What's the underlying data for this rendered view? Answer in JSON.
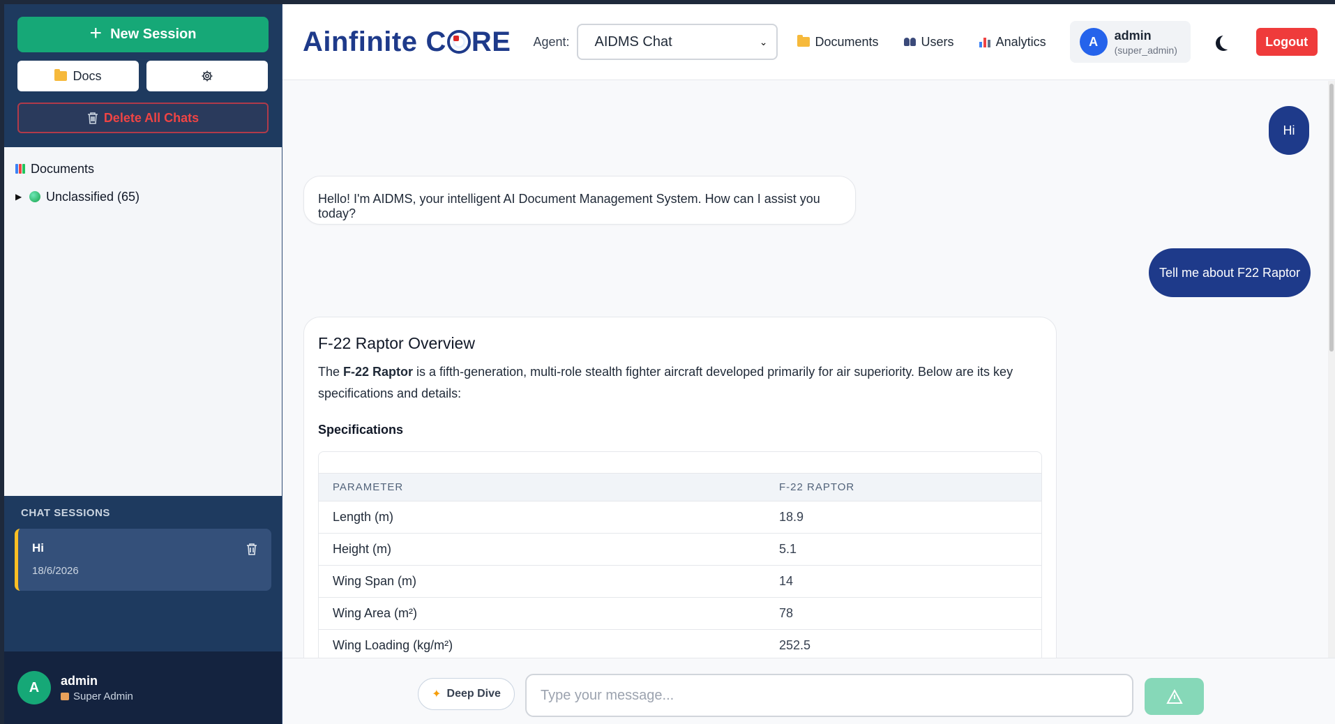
{
  "sidebar": {
    "new_session_label": "New Session",
    "docs_label": "Docs",
    "delete_all_label": "Delete All Chats",
    "tree": {
      "documents_label": "Documents",
      "unclassified_label": "Unclassified (65)"
    },
    "sessions_title": "CHAT SESSIONS",
    "sessions": [
      {
        "name": "Hi",
        "date": "18/6/2026"
      }
    ],
    "user": {
      "initial": "A",
      "name": "admin",
      "role": "Super Admin"
    }
  },
  "header": {
    "logo_part1": "Ainfinite",
    "logo_core_c": "C",
    "logo_core_rest": "RE",
    "agent_label": "Agent:",
    "agent_value": "AIDMS Chat",
    "nav": {
      "documents": "Documents",
      "users": "Users",
      "analytics": "Analytics"
    },
    "user": {
      "initial": "A",
      "name": "admin",
      "role": "(super_admin)"
    },
    "logout_label": "Logout"
  },
  "chat": {
    "messages": [
      {
        "role": "user",
        "text": "Hi"
      },
      {
        "role": "assistant",
        "text": "Hello! I'm AIDMS, your intelligent AI Document Management System. How can I assist you today?"
      },
      {
        "role": "user",
        "text": "Tell me about F22 Raptor"
      }
    ],
    "card": {
      "title": "F-22 Raptor Overview",
      "intro_pre": "The ",
      "intro_bold": "F-22 Raptor",
      "intro_post": " is a fifth-generation, multi-role stealth fighter aircraft developed primarily for air superiority. Below are its key specifications and details:",
      "subtitle": "Specifications",
      "table": {
        "headers": [
          "PARAMETER",
          "F-22 RAPTOR"
        ],
        "rows": [
          [
            "Length (m)",
            "18.9"
          ],
          [
            "Height (m)",
            "5.1"
          ],
          [
            "Wing Span (m)",
            "14"
          ],
          [
            "Wing Area (m²)",
            "78"
          ],
          [
            "Wing Loading (kg/m²)",
            "252.5"
          ]
        ]
      }
    }
  },
  "composer": {
    "deep_dive_label": "Deep Dive",
    "placeholder": "Type your message..."
  },
  "colors": {
    "primary_green": "#16a877",
    "navy": "#1e3a8a",
    "sidebar_bg": "#1e3a5f",
    "logout_red": "#ef3b3b",
    "accent_yellow": "#fbbf24"
  },
  "icons": {
    "new_session": "plus-icon",
    "docs": "folder-icon",
    "settings": "gear-icon",
    "delete_all": "trash-icon",
    "theme": "moon-icon",
    "send": "send-icon"
  }
}
